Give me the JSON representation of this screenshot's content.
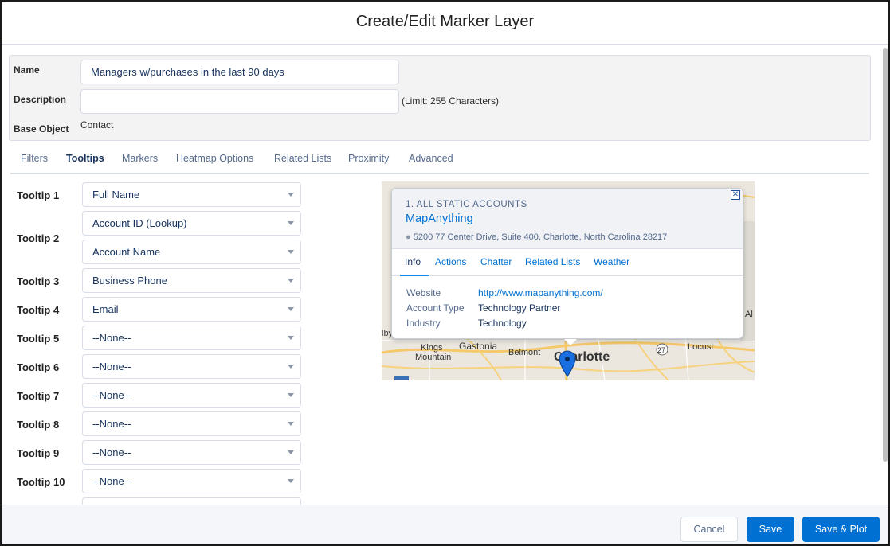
{
  "dialog": {
    "title": "Create/Edit Marker Layer"
  },
  "form": {
    "name_label": "Name",
    "name_value": "Managers w/purchases in the last 90 days",
    "description_label": "Description",
    "description_value": "",
    "limit_note": "(Limit: 255 Characters)",
    "base_object_label": "Base Object",
    "base_object_value": "Contact"
  },
  "tabs": [
    "Filters",
    "Tooltips",
    "Markers",
    "Heatmap Options",
    "Related Lists",
    "Proximity",
    "Advanced"
  ],
  "active_tab": "Tooltips",
  "tooltips": [
    {
      "label": "Tooltip 1",
      "values": [
        "Full Name"
      ]
    },
    {
      "label": "Tooltip 2",
      "values": [
        "Account ID (Lookup)",
        "Account Name"
      ]
    },
    {
      "label": "Tooltip 3",
      "values": [
        "Business Phone"
      ]
    },
    {
      "label": "Tooltip 4",
      "values": [
        "Email"
      ]
    },
    {
      "label": "Tooltip 5",
      "values": [
        "--None--"
      ]
    },
    {
      "label": "Tooltip 6",
      "values": [
        "--None--"
      ]
    },
    {
      "label": "Tooltip 7",
      "values": [
        "--None--"
      ]
    },
    {
      "label": "Tooltip 8",
      "values": [
        "--None--"
      ]
    },
    {
      "label": "Tooltip 9",
      "values": [
        "--None--"
      ]
    },
    {
      "label": "Tooltip 10",
      "values": [
        "--None--"
      ]
    }
  ],
  "preview": {
    "layer_name": "1. ALL STATIC ACCOUNTS",
    "record_name": "MapAnything",
    "address": "5200 77 Center Drive, Suite 400, Charlotte, North Carolina 28217",
    "tabs": [
      "Info",
      "Actions",
      "Chatter",
      "Related Lists",
      "Weather"
    ],
    "fields": [
      {
        "key": "Website",
        "value": "http://www.mapanything.com/"
      },
      {
        "key": "Account Type",
        "value": "Technology Partner"
      },
      {
        "key": "Industry",
        "value": "Technology"
      }
    ],
    "map_labels": {
      "charlotte": "Charlotte",
      "gastonia": "Gastonia",
      "belmont": "Belmont",
      "kings_mountain": "Kings\nMountain",
      "locust": "Locust",
      "shelby_partial": "lby",
      "edge_right": "Al",
      "route_27": "27"
    }
  },
  "buttons": {
    "cancel": "Cancel",
    "save": "Save",
    "save_plot": "Save & Plot"
  },
  "colors": {
    "brand": "#0070d2",
    "marker": "#1a6fe0",
    "text": "#16325c"
  }
}
